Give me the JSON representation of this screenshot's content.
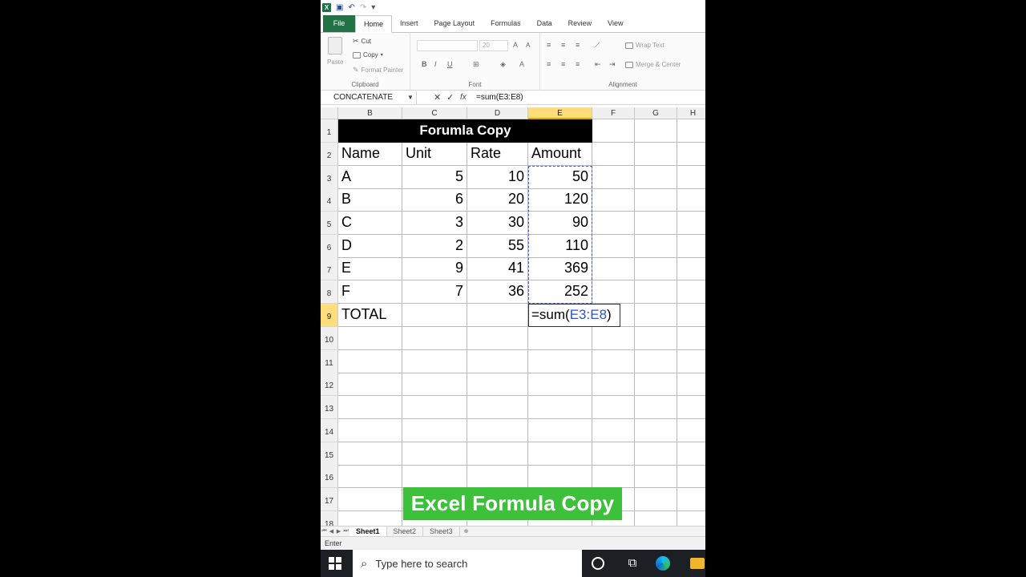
{
  "qat": {
    "app_icon": "X"
  },
  "ribbon": {
    "tabs": [
      "File",
      "Home",
      "Insert",
      "Page Layout",
      "Formulas",
      "Data",
      "Review",
      "View"
    ],
    "clipboard": {
      "paste": "Paste",
      "cut": "Cut",
      "copy": "Copy",
      "format_painter": "Format Painter",
      "label": "Clipboard"
    },
    "font": {
      "size": "20",
      "label": "Font",
      "bold": "B",
      "italic": "I",
      "underline": "U"
    },
    "alignment": {
      "wrap_text": "Wrap Text",
      "merge_center": "Merge & Center",
      "label": "Alignment"
    }
  },
  "formula_bar": {
    "name_box": "CONCATENATE",
    "formula": "=sum(E3:E8)",
    "cancel": "✕",
    "enter": "✓",
    "fx": "fx"
  },
  "columns": [
    "B",
    "C",
    "D",
    "E",
    "F",
    "G",
    "H"
  ],
  "selected_column": "E",
  "rows": [
    "1",
    "2",
    "3",
    "4",
    "5",
    "6",
    "7",
    "8",
    "9",
    "10",
    "11",
    "12",
    "13",
    "14",
    "15",
    "16",
    "17",
    "18"
  ],
  "sheet": {
    "title": "Forumla Copy",
    "headers": [
      "Name",
      "Unit",
      "Rate",
      "Amount"
    ],
    "data": [
      [
        "A",
        "5",
        "10",
        "50"
      ],
      [
        "B",
        "6",
        "20",
        "120"
      ],
      [
        "C",
        "3",
        "30",
        "90"
      ],
      [
        "D",
        "2",
        "55",
        "110"
      ],
      [
        "E",
        "9",
        "41",
        "369"
      ],
      [
        "F",
        "7",
        "36",
        "252"
      ]
    ],
    "total_label": "TOTAL",
    "edit_prefix": "=sum(",
    "edit_ref": "E3:E8",
    "edit_suffix": ")"
  },
  "overlay_label": "Excel Formula Copy",
  "sheet_tabs": [
    "Sheet1",
    "Sheet2",
    "Sheet3"
  ],
  "status": "Enter",
  "taskbar": {
    "search_placeholder": "Type here to search"
  },
  "colors": {
    "excel_green": "#217346",
    "selected_header": "#ffdd7a",
    "overlay_green": "#3ec13a",
    "ref_blue": "#2b54c8"
  }
}
